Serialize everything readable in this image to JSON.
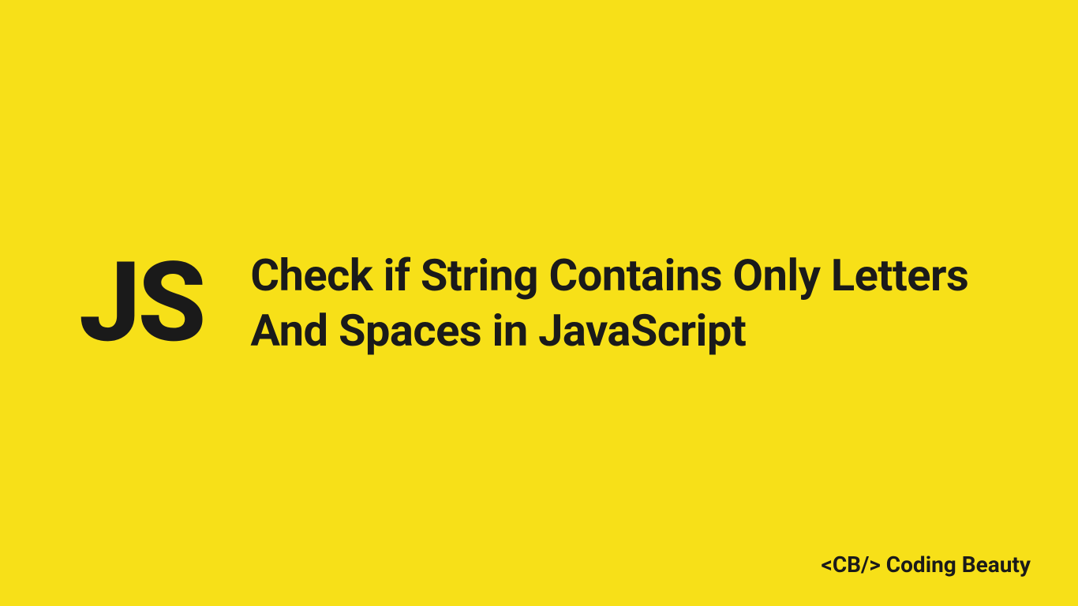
{
  "badge": "JS",
  "title": "Check if String Contains Only Letters And Spaces in JavaScript",
  "footer": "<CB/> Coding Beauty"
}
